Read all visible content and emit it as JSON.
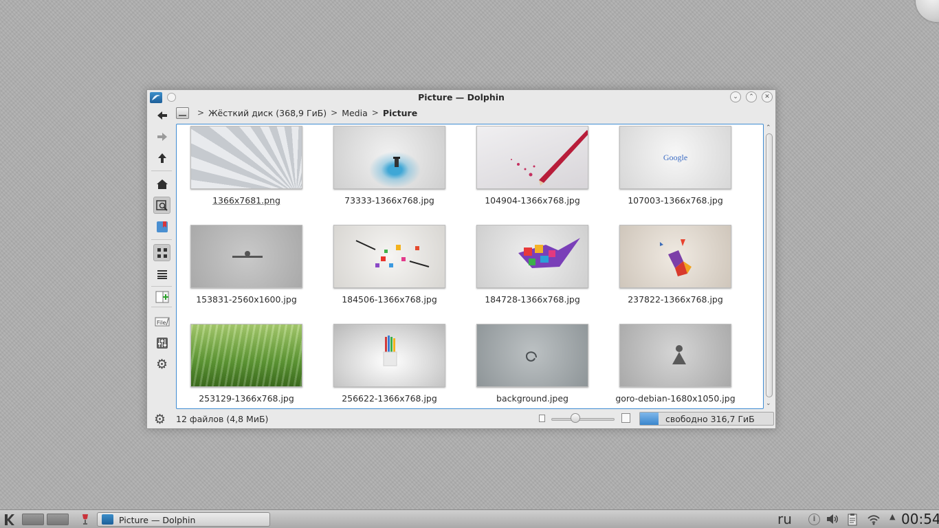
{
  "window": {
    "title": "Picture — Dolphin"
  },
  "breadcrumb": {
    "items": [
      "Жёсткий диск (368,9 ГиБ)",
      "Media",
      "Picture"
    ]
  },
  "files": [
    {
      "name": "1366x7681.png"
    },
    {
      "name": "73333-1366x768.jpg"
    },
    {
      "name": "104904-1366x768.jpg"
    },
    {
      "name": "107003-1366x768.jpg"
    },
    {
      "name": "153831-2560x1600.jpg"
    },
    {
      "name": "184506-1366x768.jpg"
    },
    {
      "name": "184728-1366x768.jpg"
    },
    {
      "name": "237822-1366x768.jpg"
    },
    {
      "name": "253129-1366x768.jpg"
    },
    {
      "name": "256622-1366x768.jpg"
    },
    {
      "name": "background.jpeg"
    },
    {
      "name": "goro-debian-1680x1050.jpg"
    }
  ],
  "thumbnails": {
    "google_text": "Google"
  },
  "status": {
    "summary": "12 файлов (4,8 МиБ)",
    "free_space": "свободно 316,7 ГиБ",
    "free_space_used_fraction": 0.14
  },
  "taskbar": {
    "task_label": "Picture — Dolphin",
    "language": "ru",
    "clock": "00:54"
  },
  "colors": {
    "accent": "#3d8bd2"
  }
}
